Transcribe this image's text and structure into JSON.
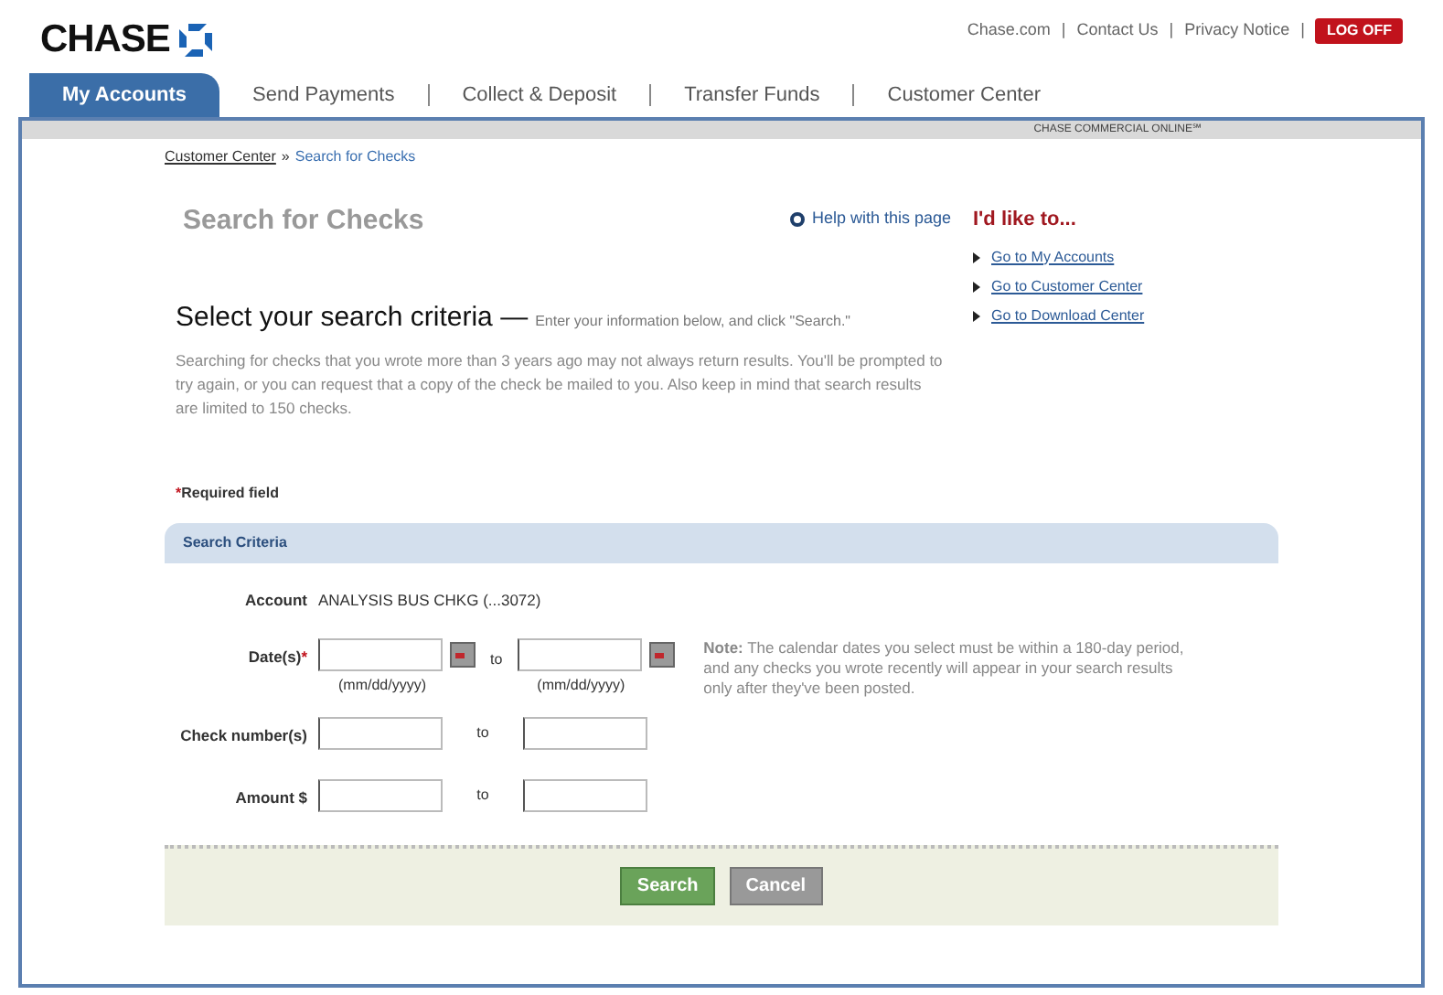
{
  "logo": "CHASE",
  "top_links": [
    {
      "label": "Chase.com"
    },
    {
      "label": "Contact Us"
    },
    {
      "label": "Privacy Notice"
    }
  ],
  "link_divider": "|",
  "logoff": "LOG OFF",
  "tabs": [
    {
      "label": "My Accounts",
      "selected": true
    },
    {
      "label": "Send Payments",
      "selected": false
    },
    {
      "label": "Collect & Deposit",
      "selected": false
    },
    {
      "label": "Transfer Funds",
      "selected": false
    },
    {
      "label": "Customer Center",
      "selected": false
    }
  ],
  "brand_band": "CHASE COMMERCIAL ONLINE℠",
  "breadcrumb": {
    "parent": "Customer Center",
    "separator": "»",
    "current": "Search for Checks"
  },
  "page_title": "Search for Checks",
  "help_link": "Help with this page",
  "sidebar": {
    "title": "I'd like to...",
    "links": [
      "Go to My Accounts",
      "Go to Customer Center",
      "Go to Download Center"
    ]
  },
  "criteria_heading": "Select your search criteria —",
  "criteria_hint": "Enter your information below, and click \"Search.\"",
  "intro": "Searching for checks that you wrote more than 3 years ago may not always return results. You'll be prompted to try again, or you can request that a copy of the check be mailed to you. Also keep in mind that search results are limited to 150 checks.",
  "required_mark": "*",
  "required_note": "Required field",
  "panel_title": "Search Criteria",
  "account": {
    "label": "Account",
    "value": "ANALYSIS BUS CHKG (...3072)"
  },
  "fields": [
    {
      "kind": "date",
      "label": "Date(s)",
      "required": true,
      "separator": "to",
      "hints": [
        "(mm/dd/yyyy)",
        "(mm/dd/yyyy)"
      ],
      "note": "**Note:** The calendar dates you select must be within a 180-day period, and any checks you wrote recently will appear in your search results only after they've been posted."
    },
    {
      "kind": "range",
      "label": "Check number(s)",
      "required": false,
      "separator": "to"
    },
    {
      "kind": "range",
      "label": "Amount $",
      "required": false,
      "separator": "to"
    }
  ],
  "buttons": [
    {
      "kind": "primary",
      "label": "Search"
    },
    {
      "kind": "secondary",
      "label": "Cancel"
    }
  ]
}
